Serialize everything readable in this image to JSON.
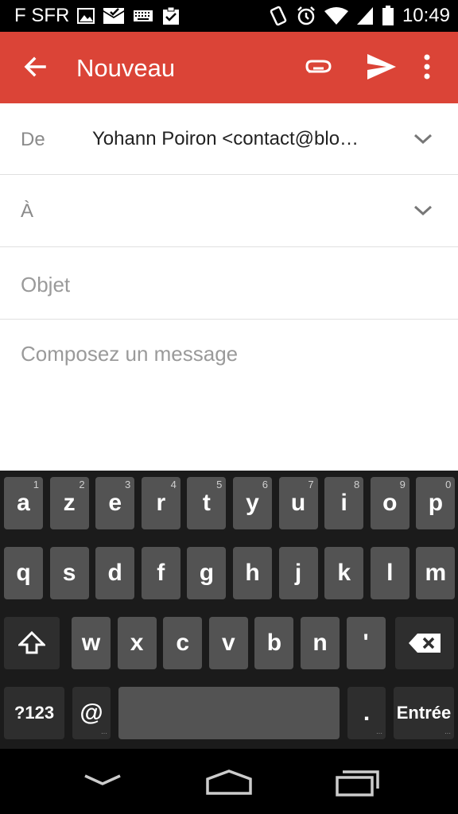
{
  "status_bar": {
    "carrier": "F SFR",
    "time": "10:49",
    "icons": [
      "image-icon",
      "mail-check-icon",
      "keyboard-icon",
      "clipboard-check-icon",
      "vibrate-icon",
      "alarm-icon",
      "wifi-icon",
      "signal-icon",
      "battery-icon"
    ]
  },
  "app_bar": {
    "title": "Nouveau",
    "color": "#db4437"
  },
  "compose": {
    "from_label": "De",
    "from_value": "Yohann Poiron  <contact@blo…",
    "to_label": "À",
    "subject_placeholder": "Objet",
    "body_placeholder": "Composez un message"
  },
  "keyboard": {
    "row1": [
      {
        "label": "a",
        "hint": "1"
      },
      {
        "label": "z",
        "hint": "2"
      },
      {
        "label": "e",
        "hint": "3"
      },
      {
        "label": "r",
        "hint": "4"
      },
      {
        "label": "t",
        "hint": "5"
      },
      {
        "label": "y",
        "hint": "6"
      },
      {
        "label": "u",
        "hint": "7"
      },
      {
        "label": "i",
        "hint": "8"
      },
      {
        "label": "o",
        "hint": "9"
      },
      {
        "label": "p",
        "hint": "0"
      }
    ],
    "row2": [
      "q",
      "s",
      "d",
      "f",
      "g",
      "h",
      "j",
      "k",
      "l",
      "m"
    ],
    "row3": [
      "w",
      "x",
      "c",
      "v",
      "b",
      "n",
      "'"
    ],
    "symbols_label": "?123",
    "at_label": "@",
    "period_label": ".",
    "enter_label": "Entrée"
  }
}
